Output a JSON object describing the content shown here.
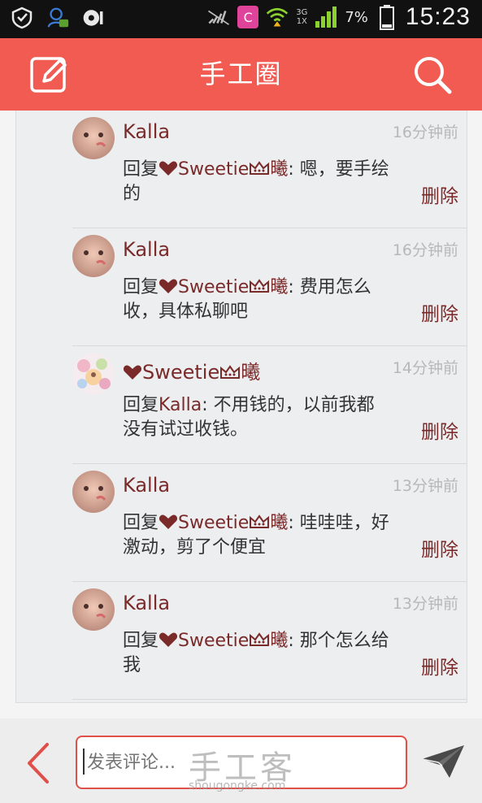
{
  "status_bar": {
    "time": "15:23",
    "battery": "7%",
    "net_top": "3G",
    "net_bottom": "1X",
    "app_badge": "C",
    "icons": [
      "shield-icon",
      "contacts-icon",
      "sync-icon",
      "no-signal-icon",
      "app-icon",
      "wifi-icon",
      "signal-icon",
      "battery-icon"
    ]
  },
  "header": {
    "title": "手工圈",
    "left_icon": "edit-icon",
    "right_icon": "search-icon"
  },
  "comments": [
    {
      "user": "Kalla",
      "time": "16分钟前",
      "prefix": "回复",
      "target": "Sweetie",
      "target_suffix": "曦",
      "text": ": 嗯，要手绘的",
      "delete": "删除",
      "avatar": "kalla"
    },
    {
      "user": "Kalla",
      "time": "16分钟前",
      "prefix": "回复",
      "target": "Sweetie",
      "target_suffix": "曦",
      "text": ": 费用怎么收，具体私聊吧",
      "delete": "删除",
      "avatar": "kalla"
    },
    {
      "user": "Sweetie",
      "user_suffix": "曦",
      "time": "14分钟前",
      "prefix": "回复",
      "target": "Kalla",
      "text": ": 不用钱的，以前我都没有试过收钱。",
      "delete": "删除",
      "avatar": "sweetie"
    },
    {
      "user": "Kalla",
      "time": "13分钟前",
      "prefix": "回复",
      "target": "Sweetie",
      "target_suffix": "曦",
      "text": ": 哇哇哇，好激动，剪了个便宜",
      "delete": "删除",
      "avatar": "kalla"
    },
    {
      "user": "Kalla",
      "time": "13分钟前",
      "prefix": "回复",
      "target": "Sweetie",
      "target_suffix": "曦",
      "text": ": 那个怎么给我",
      "delete": "删除",
      "avatar": "kalla"
    }
  ],
  "footer": {
    "placeholder": "发表评论...",
    "watermark": "手工客",
    "watermark_sub": "shougongke.com",
    "left_icon": "back-chevron-icon",
    "right_icon": "send-icon"
  },
  "colors": {
    "accent": "#f15b52",
    "name": "#7b2a2a",
    "time": "#b8b8b8"
  }
}
